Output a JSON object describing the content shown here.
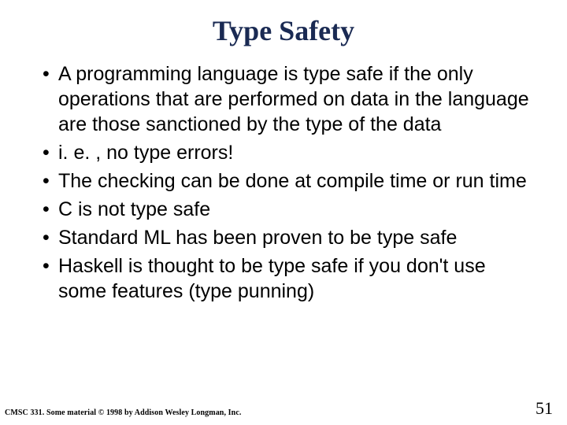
{
  "title": "Type Safety",
  "bullets": [
    "A programming language is type safe if the only operations that are performed on data in the language are those sanctioned by the type of the data",
    "i. e. , no type errors!",
    "The checking can be done at compile time or run time",
    "C is not type safe",
    "Standard ML has been proven to be type safe",
    "Haskell is thought to be type safe if you don't use some features (type punning)"
  ],
  "footer_left": "CMSC 331.  Some material © 1998 by Addison Wesley Longman, Inc.",
  "page_number": "51"
}
